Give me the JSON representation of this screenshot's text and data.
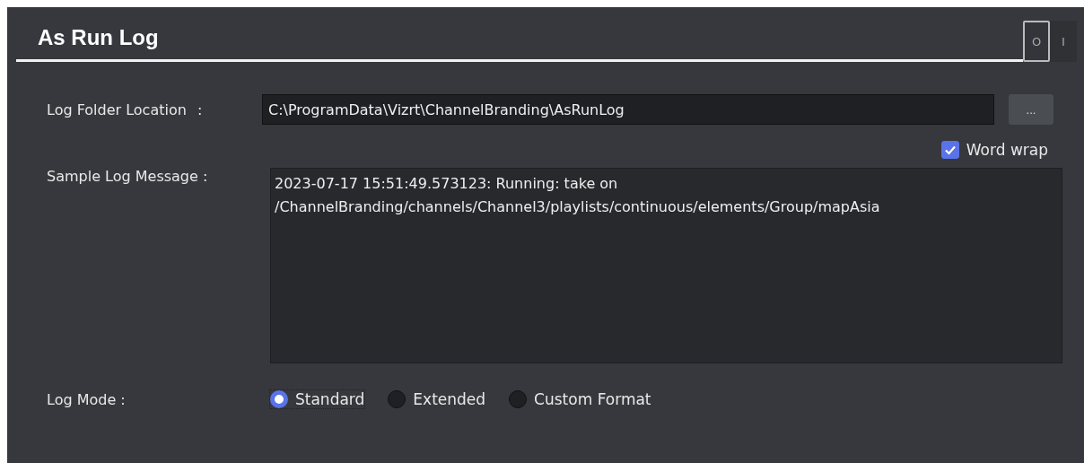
{
  "header": {
    "title": "As Run Log",
    "toggle": {
      "on": false,
      "off_label": "O",
      "on_label": "I"
    }
  },
  "folder": {
    "label": "Log Folder Location",
    "separator": ":",
    "value": "C:\\ProgramData\\Vizrt\\ChannelBranding\\AsRunLog",
    "browse": "..."
  },
  "word_wrap": {
    "label": "Word wrap",
    "checked": true
  },
  "sample": {
    "label": "Sample Log Message :",
    "value": "2023-07-17 15:51:49.573123: Running: take on /ChannelBranding/channels/Channel3/playlists/continuous/elements/Group/mapAsia"
  },
  "log_mode": {
    "label": "Log Mode :",
    "options": [
      {
        "label": "Standard",
        "selected": true
      },
      {
        "label": "Extended",
        "selected": false
      },
      {
        "label": "Custom Format",
        "selected": false
      }
    ]
  }
}
